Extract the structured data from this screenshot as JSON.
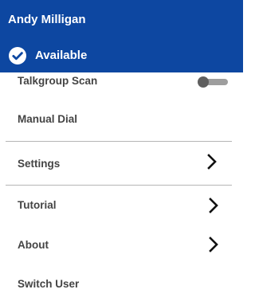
{
  "header": {
    "user_name": "Andy Milligan",
    "status_icon": "check-circle-icon",
    "status_label": "Available",
    "background_color": "#0d47a1"
  },
  "menu": {
    "items": [
      {
        "label": "Talkgroup Scan",
        "control": "toggle",
        "toggle_on": false
      },
      {
        "label": "Manual Dial"
      },
      {
        "label": "Settings",
        "icon": "chevron-right-icon"
      },
      {
        "label": "Tutorial",
        "icon": "chevron-right-icon"
      },
      {
        "label": "About",
        "icon": "chevron-right-icon"
      },
      {
        "label": "Switch User"
      }
    ]
  }
}
